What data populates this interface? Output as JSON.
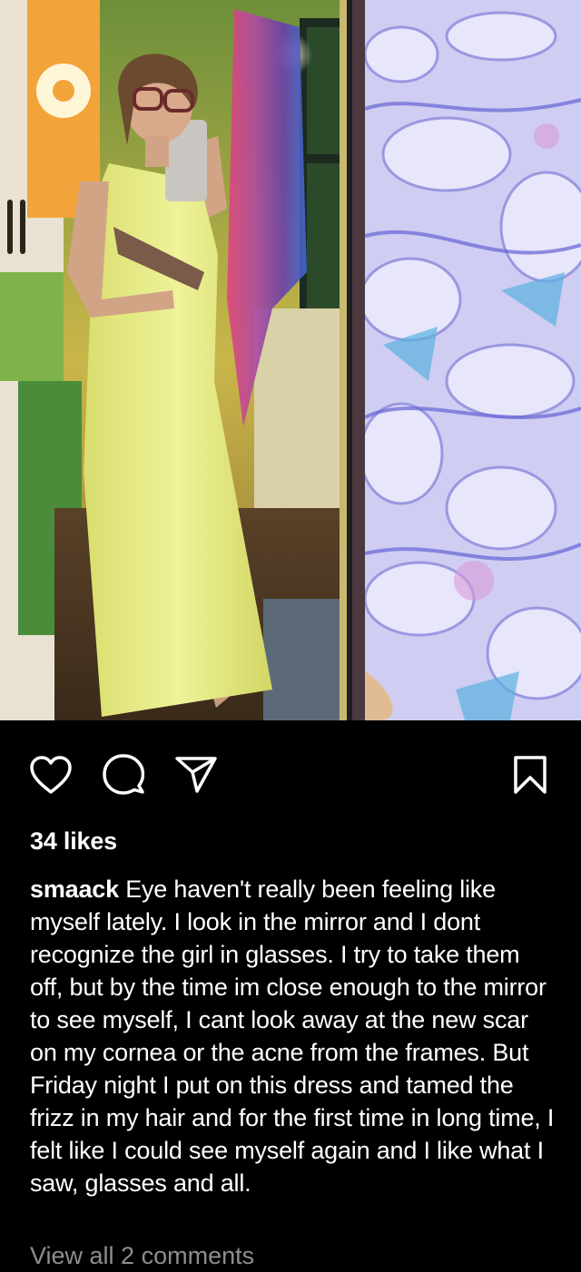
{
  "post": {
    "likes_text": "34 likes",
    "username": "smaack",
    "caption_text": "Eye haven't really been feeling like myself lately. I look in the mirror and I dont recognize the girl in glasses. I try to take them off, but by the time im close enough to the mirror to see myself, I cant look away at the new scar on my cornea or the acne from the frames. But Friday night I put on this dress and tamed the frizz in my hair and for the first time in long time, I felt like I could see myself again and I like what I saw, glasses and all.",
    "view_comments_text": "View all 2 comments"
  },
  "icons": {
    "like": "heart-icon",
    "comment": "speech-bubble-icon",
    "share": "paper-plane-icon",
    "save": "bookmark-icon"
  },
  "colors": {
    "background": "#000000",
    "text": "#ffffff",
    "muted_text": "#8e8e8e",
    "dress": "#e8ec8a",
    "watercolor": "#c9c6f0"
  }
}
